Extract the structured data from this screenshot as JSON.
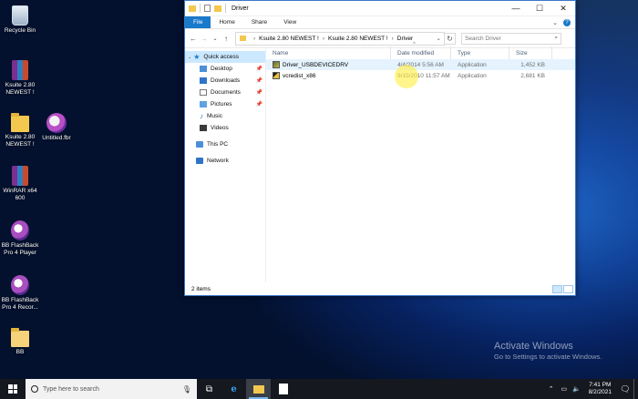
{
  "desktop": {
    "icons": [
      {
        "label": "Recycle Bin",
        "icon": "recycle-bin-icon"
      },
      {
        "label": "Ksuite 2.80 NEWEST !",
        "icon": "winrar-archive-icon"
      },
      {
        "label": "Ksuite 2.80 NEWEST !",
        "icon": "folder-icon"
      },
      {
        "label": "Untitled.fbr",
        "icon": "fbr-file-icon"
      },
      {
        "label": "WinRAR x64 600",
        "icon": "winrar-app-icon"
      },
      {
        "label": "BB FlashBack Pro 4 Player",
        "icon": "flashback-player-icon"
      },
      {
        "label": "BB FlashBack Pro 4 Recor...",
        "icon": "flashback-recorder-icon"
      },
      {
        "label": "BB",
        "icon": "document-icon"
      }
    ],
    "watermark": {
      "title": "Activate Windows",
      "subtitle": "Go to Settings to activate Windows."
    }
  },
  "explorer": {
    "title": "Driver",
    "window_controls": {
      "minimize": "—",
      "maximize": "☐",
      "close": "✕"
    },
    "ribbon_tabs": [
      "File",
      "Home",
      "Share",
      "View"
    ],
    "breadcrumb": [
      "Ksuite 2.80 NEWEST !",
      "Ksuite 2.80 NEWEST !",
      "Driver"
    ],
    "search_placeholder": "Search Driver",
    "nav_pane": {
      "quick_access": "Quick access",
      "items": [
        "Desktop",
        "Downloads",
        "Documents",
        "Pictures",
        "Music",
        "Videos"
      ],
      "this_pc": "This PC",
      "network": "Network"
    },
    "columns": [
      "Name",
      "Date modified",
      "Type",
      "Size"
    ],
    "files": [
      {
        "name": "Driver_USBDEVICEDRV",
        "date": "4/4/2014 5:56 AM",
        "type": "Application",
        "size": "1,452 KB"
      },
      {
        "name": "vcredist_x86",
        "date": "9/15/2010 11:57 AM",
        "type": "Application",
        "size": "2,681 KB"
      }
    ],
    "status": "2 items"
  },
  "taskbar": {
    "search_placeholder": "Type here to search",
    "time": "7:41 PM",
    "date": "8/2/2021"
  }
}
